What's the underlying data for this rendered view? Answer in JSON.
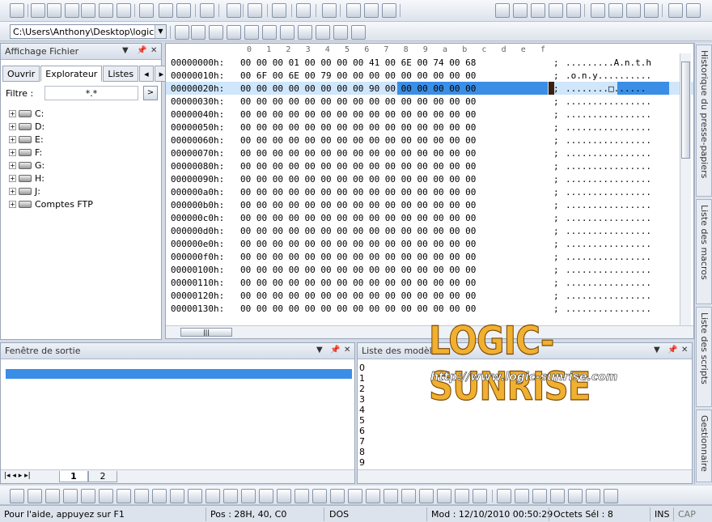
{
  "path_combo": "C:\\Users\\Anthony\\Desktop\\logic",
  "left_panel": {
    "title": "Affichage Fichier",
    "tabs": [
      "Ouvrir",
      "Explorateur",
      "Listes"
    ],
    "filter_label": "Filtre :",
    "filter_value": "*.*",
    "filter_button": ">",
    "tree": [
      "C:",
      "D:",
      "E:",
      "F:",
      "G:",
      "H:",
      "J:",
      "Comptes FTP"
    ]
  },
  "hex": {
    "columns": [
      "0",
      "1",
      "2",
      "3",
      "4",
      "5",
      "6",
      "7",
      "8",
      "9",
      "a",
      "b",
      "c",
      "d",
      "e",
      "f"
    ],
    "rows": [
      {
        "off": "00000000h:",
        "bytes": "00 00 00 01 00 00 00 00 41 00 6E 00 74 00 68",
        "ascii": ".........A.n.t.h"
      },
      {
        "off": "00000010h:",
        "bytes": "00 6F 00 6E 00 79 00 00 00 00 00 00 00 00 00",
        "ascii": ".o.n.y.........."
      },
      {
        "off": "00000020h:",
        "bytes": "00 00 00 00 00 00 00 00 90 00 00 00 00 00 00",
        "ascii": "........□......"
      },
      {
        "off": "00000030h:",
        "bytes": "00 00 00 00 00 00 00 00 00 00 00 00 00 00 00",
        "ascii": "................"
      },
      {
        "off": "00000040h:",
        "bytes": "00 00 00 00 00 00 00 00 00 00 00 00 00 00 00",
        "ascii": "................"
      },
      {
        "off": "00000050h:",
        "bytes": "00 00 00 00 00 00 00 00 00 00 00 00 00 00 00",
        "ascii": "................"
      },
      {
        "off": "00000060h:",
        "bytes": "00 00 00 00 00 00 00 00 00 00 00 00 00 00 00",
        "ascii": "................"
      },
      {
        "off": "00000070h:",
        "bytes": "00 00 00 00 00 00 00 00 00 00 00 00 00 00 00",
        "ascii": "................"
      },
      {
        "off": "00000080h:",
        "bytes": "00 00 00 00 00 00 00 00 00 00 00 00 00 00 00",
        "ascii": "................"
      },
      {
        "off": "00000090h:",
        "bytes": "00 00 00 00 00 00 00 00 00 00 00 00 00 00 00",
        "ascii": "................"
      },
      {
        "off": "000000a0h:",
        "bytes": "00 00 00 00 00 00 00 00 00 00 00 00 00 00 00",
        "ascii": "................"
      },
      {
        "off": "000000b0h:",
        "bytes": "00 00 00 00 00 00 00 00 00 00 00 00 00 00 00",
        "ascii": "................"
      },
      {
        "off": "000000c0h:",
        "bytes": "00 00 00 00 00 00 00 00 00 00 00 00 00 00 00",
        "ascii": "................"
      },
      {
        "off": "000000d0h:",
        "bytes": "00 00 00 00 00 00 00 00 00 00 00 00 00 00 00",
        "ascii": "................"
      },
      {
        "off": "000000e0h:",
        "bytes": "00 00 00 00 00 00 00 00 00 00 00 00 00 00 00",
        "ascii": "................"
      },
      {
        "off": "000000f0h:",
        "bytes": "00 00 00 00 00 00 00 00 00 00 00 00 00 00 00",
        "ascii": "................"
      },
      {
        "off": "00000100h:",
        "bytes": "00 00 00 00 00 00 00 00 00 00 00 00 00 00 00",
        "ascii": "................"
      },
      {
        "off": "00000110h:",
        "bytes": "00 00 00 00 00 00 00 00 00 00 00 00 00 00 00",
        "ascii": "................"
      },
      {
        "off": "00000120h:",
        "bytes": "00 00 00 00 00 00 00 00 00 00 00 00 00 00 00",
        "ascii": "................"
      },
      {
        "off": "00000130h:",
        "bytes": "00 00 00 00 00 00 00 00 00 00 00 00 00 00 00",
        "ascii": "................"
      }
    ]
  },
  "right_tabs": [
    "Historique du presse-papiers",
    "Liste des macros",
    "Liste des scripts",
    "Gestionnaire"
  ],
  "output_panel": {
    "title": "Fenêtre de sortie",
    "tab1": "1",
    "tab2": "2"
  },
  "models_panel": {
    "title": "Liste des modèl",
    "items": [
      "0",
      "1",
      "2",
      "3",
      "4",
      "5",
      "6",
      "7",
      "8",
      "9"
    ]
  },
  "watermark": {
    "title": "LOGIC-SUNRISE",
    "url": "http://www.logic-sunrise.com"
  },
  "status": {
    "help": "Pour l'aide, appuyez sur F1",
    "pos": "Pos : 28H, 40, C0",
    "format": "DOS",
    "mod": "Mod : 12/10/2010 00:50:29",
    "sel": "Octets Sél : 8",
    "ins": "INS",
    "cap": "CAP"
  },
  "colors": {
    "selection": "#3a8ee6",
    "highlight_row": "#cfe6fb",
    "watermark": "#f0b030"
  }
}
